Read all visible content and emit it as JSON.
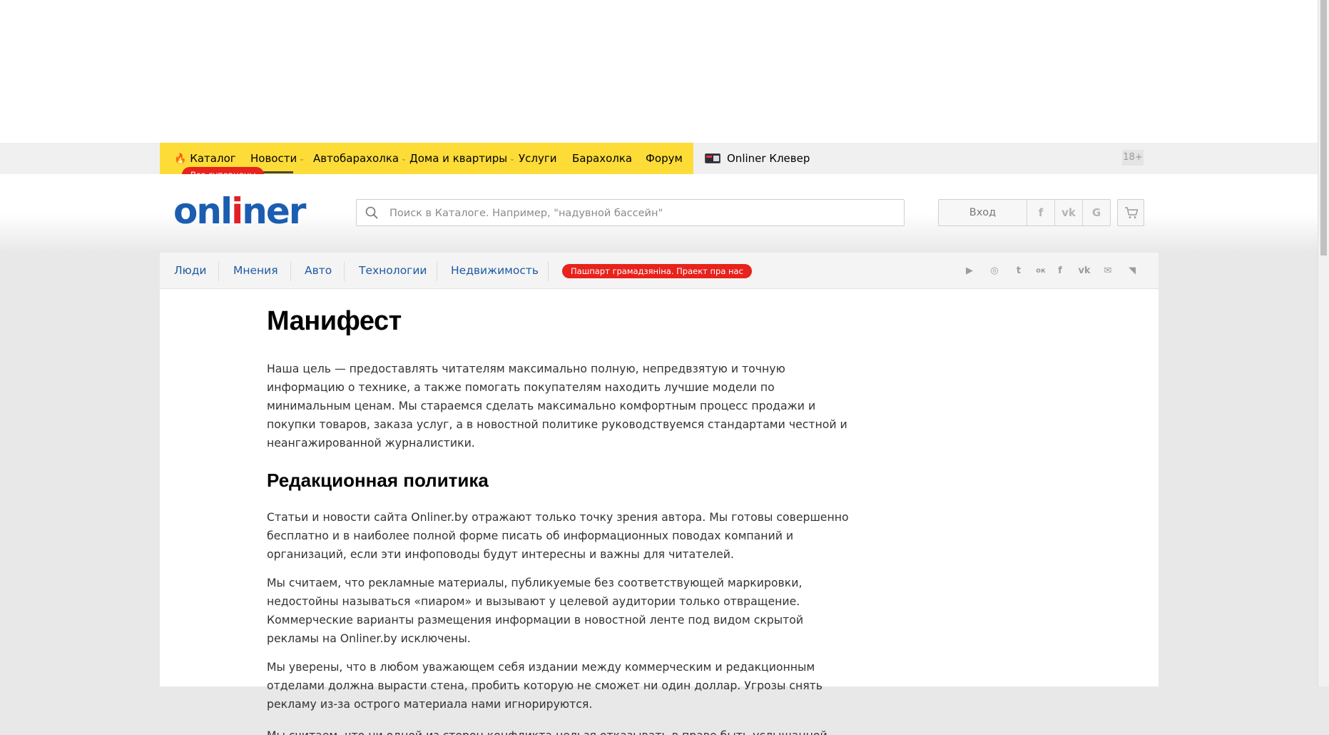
{
  "topnav": {
    "items": [
      {
        "label": "Каталог",
        "has_fire": true
      },
      {
        "label": "Новости",
        "dropdown": true,
        "active": true
      },
      {
        "label": "Автобарахолка",
        "dropdown": true
      },
      {
        "label": "Дома и квартиры",
        "dropdown": true
      },
      {
        "label": "Услуги"
      },
      {
        "label": "Барахолка"
      },
      {
        "label": "Форум"
      }
    ],
    "sale_badge": "Все суперцены",
    "klever": "Onliner Клевер",
    "age_badge": "18+",
    "bg_color": "#fedc37"
  },
  "header": {
    "logo_part1": "onl",
    "logo_part2": "i",
    "logo_part3": "ner",
    "search_placeholder": "Поиск в Каталоге. Например, \"надувной бассейн\"",
    "login_label": "Вход",
    "social_login": [
      {
        "icon": "facebook-icon",
        "glyph": "f"
      },
      {
        "icon": "vk-icon",
        "glyph": "vk"
      },
      {
        "icon": "google-icon",
        "glyph": "G"
      }
    ],
    "cart_icon": "cart-icon"
  },
  "subnav": {
    "items": [
      "Люди",
      "Мнения",
      "Авто",
      "Технологии",
      "Недвижимость"
    ],
    "passport_badge": "Пашпарт грамадзяніна. Праект пра нас",
    "social": [
      {
        "icon": "youtube-icon",
        "glyph": "▶"
      },
      {
        "icon": "instagram-icon",
        "glyph": "◎"
      },
      {
        "icon": "twitter-icon",
        "glyph": "t"
      },
      {
        "icon": "odnoklassniki-icon",
        "glyph": "ок"
      },
      {
        "icon": "facebook-icon",
        "glyph": "f"
      },
      {
        "icon": "vk-icon",
        "glyph": "vk"
      },
      {
        "icon": "mail-icon",
        "glyph": "✉"
      },
      {
        "icon": "rss-icon",
        "glyph": "◥"
      }
    ]
  },
  "article": {
    "title": "Манифест",
    "paragraph1": "Наша цель — предоставлять читателям максимально полную, непредвзятую и точную информацию о технике, а также помогать покупателям находить лучшие модели по минимальным ценам. Мы стараемся сделать максимально комфортным процесс продажи и покупки товаров, заказа услуг, а в новостной политике руководствуемся стандартами честной и неангажированной журналистики.",
    "section_title": "Редакционная политика",
    "paragraph2": "Статьи и новости сайта Onliner.by отражают только точку зрения автора. Мы готовы совершенно бесплатно и в наиболее полной форме писать об информационных поводах компаний и организаций, если эти инфоповоды будут интересны и важны для читателей.",
    "paragraph3": "Мы считаем, что рекламные материалы, публикуемые без соответствующей маркировки, недостойны называться «пиаром» и вызывают у целевой аудитории только отвращение. Коммерческие варианты размещения информации в новостной ленте под видом скрытой рекламы на Onliner.by исключены.",
    "paragraph4": "Мы уверены, что в любом уважающем себя издании между коммерческим и редакционным отделами должна вырасти стена, пробить которую не сможет ни один доллар. Угрозы снять рекламу из-за острого материала нами игнорируются.",
    "paragraph5": "Мы считаем, что ни одной из сторон конфликта нельзя отказывать в праве быть услышанной."
  }
}
